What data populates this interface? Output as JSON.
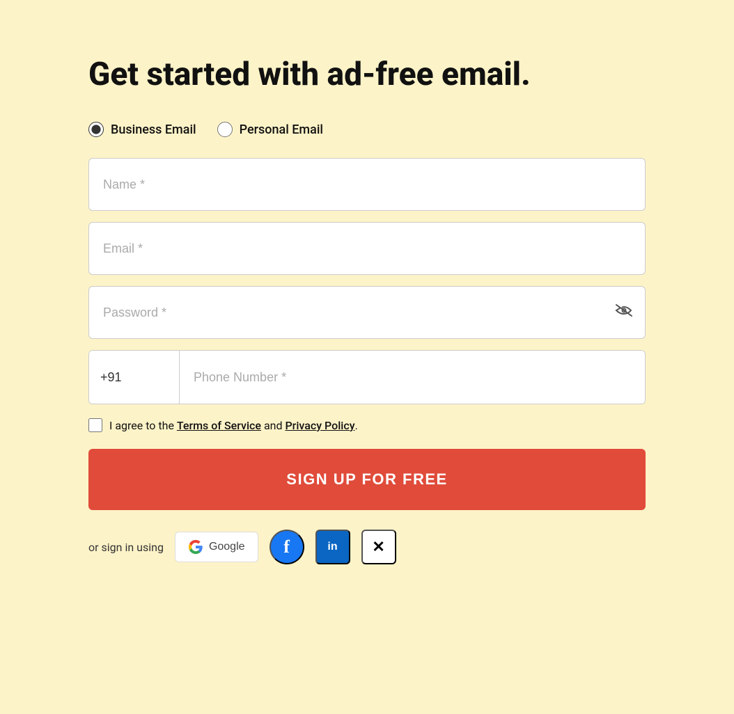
{
  "page": {
    "title": "Get started with ad-free email.",
    "background_color": "#fdf3c8"
  },
  "email_type": {
    "options": [
      {
        "id": "business",
        "label": "Business Email",
        "checked": true
      },
      {
        "id": "personal",
        "label": "Personal Email",
        "checked": false
      }
    ]
  },
  "form": {
    "name_placeholder": "Name *",
    "email_placeholder": "Email *",
    "password_placeholder": "Password *",
    "phone_code": "+91",
    "phone_placeholder": "Phone Number *"
  },
  "terms": {
    "text_before": "I agree to the ",
    "terms_label": "Terms of Service",
    "text_between": " and ",
    "privacy_label": "Privacy Policy",
    "text_after": "."
  },
  "signup_button": {
    "label": "SIGN UP FOR FREE"
  },
  "social": {
    "label": "or sign in using",
    "google_label": "Google",
    "options": [
      "Google",
      "Facebook",
      "LinkedIn",
      "X"
    ]
  }
}
